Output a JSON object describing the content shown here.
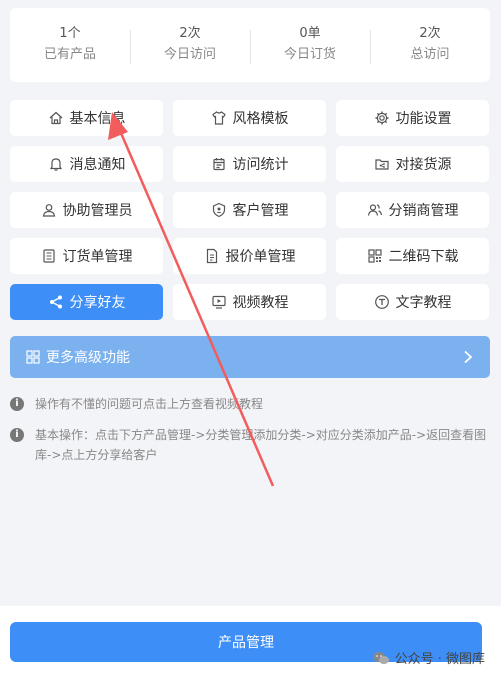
{
  "stats": [
    {
      "value": "1个",
      "label": "已有产品"
    },
    {
      "value": "2次",
      "label": "今日访问"
    },
    {
      "value": "0单",
      "label": "今日订货"
    },
    {
      "value": "2次",
      "label": "总访问"
    }
  ],
  "menu": [
    {
      "label": "基本信息",
      "icon": "home-icon"
    },
    {
      "label": "风格模板",
      "icon": "shirt-icon"
    },
    {
      "label": "功能设置",
      "icon": "gear-icon"
    },
    {
      "label": "消息通知",
      "icon": "bell-icon"
    },
    {
      "label": "访问统计",
      "icon": "calendar-icon"
    },
    {
      "label": "对接货源",
      "icon": "folder-share-icon"
    },
    {
      "label": "协助管理员",
      "icon": "user-icon"
    },
    {
      "label": "客户管理",
      "icon": "shield-icon"
    },
    {
      "label": "分销商管理",
      "icon": "users-icon"
    },
    {
      "label": "订货单管理",
      "icon": "list-icon"
    },
    {
      "label": "报价单管理",
      "icon": "document-icon"
    },
    {
      "label": "二维码下载",
      "icon": "qrcode-icon"
    },
    {
      "label": "分享好友",
      "icon": "share-icon"
    },
    {
      "label": "视频教程",
      "icon": "video-icon"
    },
    {
      "label": "文字教程",
      "icon": "text-icon"
    }
  ],
  "more": {
    "label": "更多高级功能"
  },
  "tips": [
    "操作有不懂的问题可点击上方查看视频教程",
    "基本操作：点击下方产品管理->分类管理添加分类->对应分类添加产品->返回查看图库->点上方分享给客户"
  ],
  "footer": {
    "button_label": "产品管理"
  },
  "watermark": {
    "text": "公众号 · 微图库"
  },
  "colors": {
    "accent": "#3d8ff7",
    "more_bg": "#7ab1ee",
    "arrow": "#f25c5c"
  }
}
